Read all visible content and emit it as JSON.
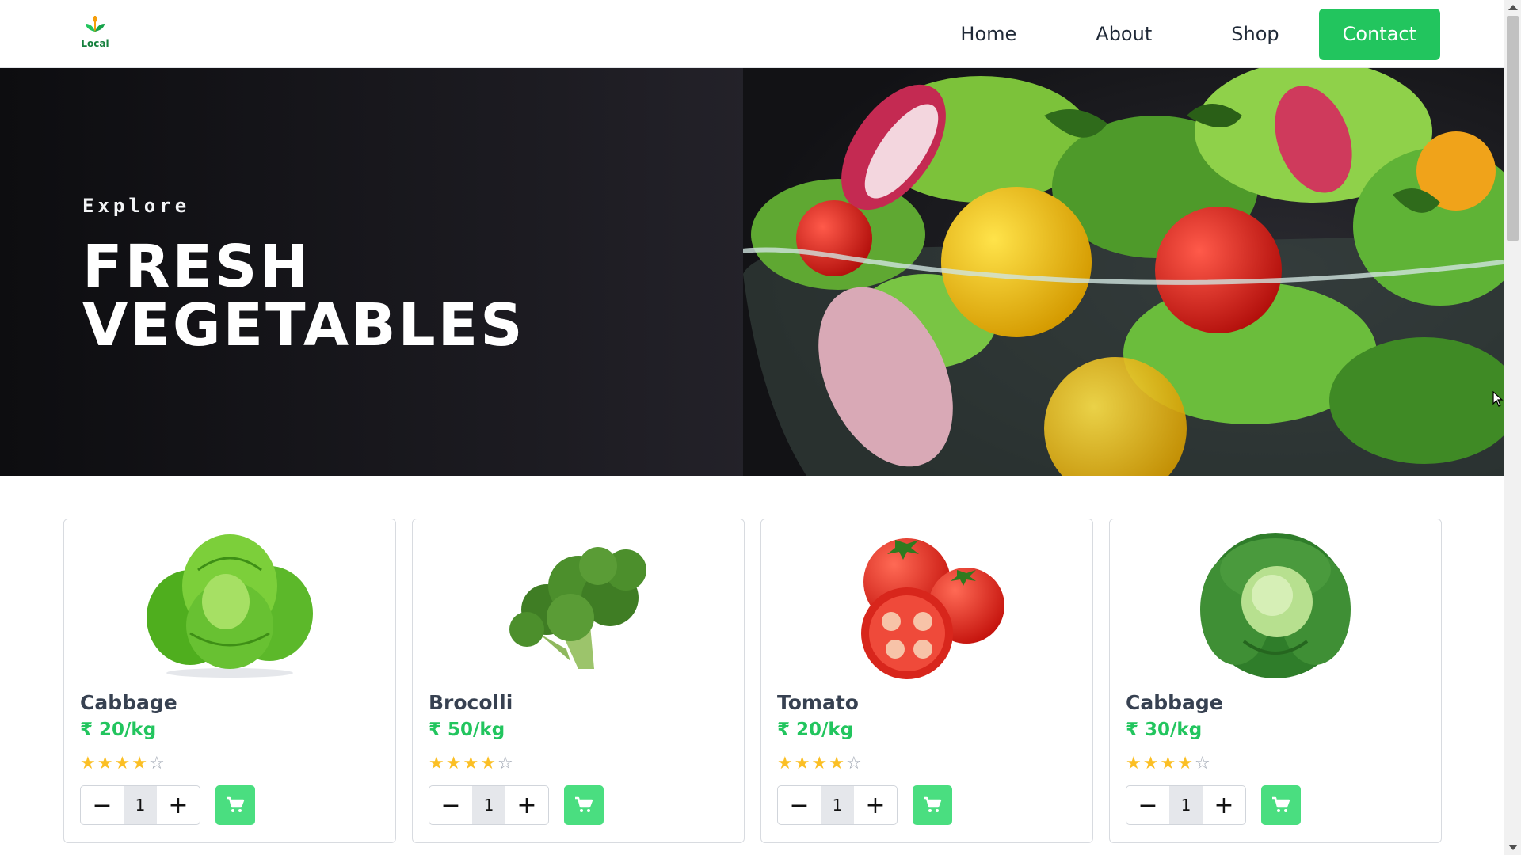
{
  "brand": {
    "logo_text": "Local"
  },
  "nav": {
    "items": [
      "Home",
      "About",
      "Shop"
    ],
    "contact_label": "Contact"
  },
  "hero": {
    "subtitle": "Explore",
    "title_line1": "FRESH",
    "title_line2": "VEGETABLES"
  },
  "products": [
    {
      "name": "Cabbage",
      "price": "₹ 20/kg",
      "rating": 4,
      "quantity": "1",
      "image": "lettuce-image"
    },
    {
      "name": "Brocolli",
      "price": "₹ 50/kg",
      "rating": 4,
      "quantity": "1",
      "image": "broccoli-image"
    },
    {
      "name": "Tomato",
      "price": "₹ 20/kg",
      "rating": 4,
      "quantity": "1",
      "image": "tomato-image"
    },
    {
      "name": "Cabbage",
      "price": "₹ 30/kg",
      "rating": 4,
      "quantity": "1",
      "image": "cabbage-image"
    }
  ],
  "icons": {
    "minus": "minus-icon",
    "plus": "plus-icon",
    "cart": "cart-icon",
    "star": "star-icon"
  },
  "colors": {
    "accent": "#22c55e",
    "cart_button": "#4ade80",
    "star": "#fbbf24"
  }
}
